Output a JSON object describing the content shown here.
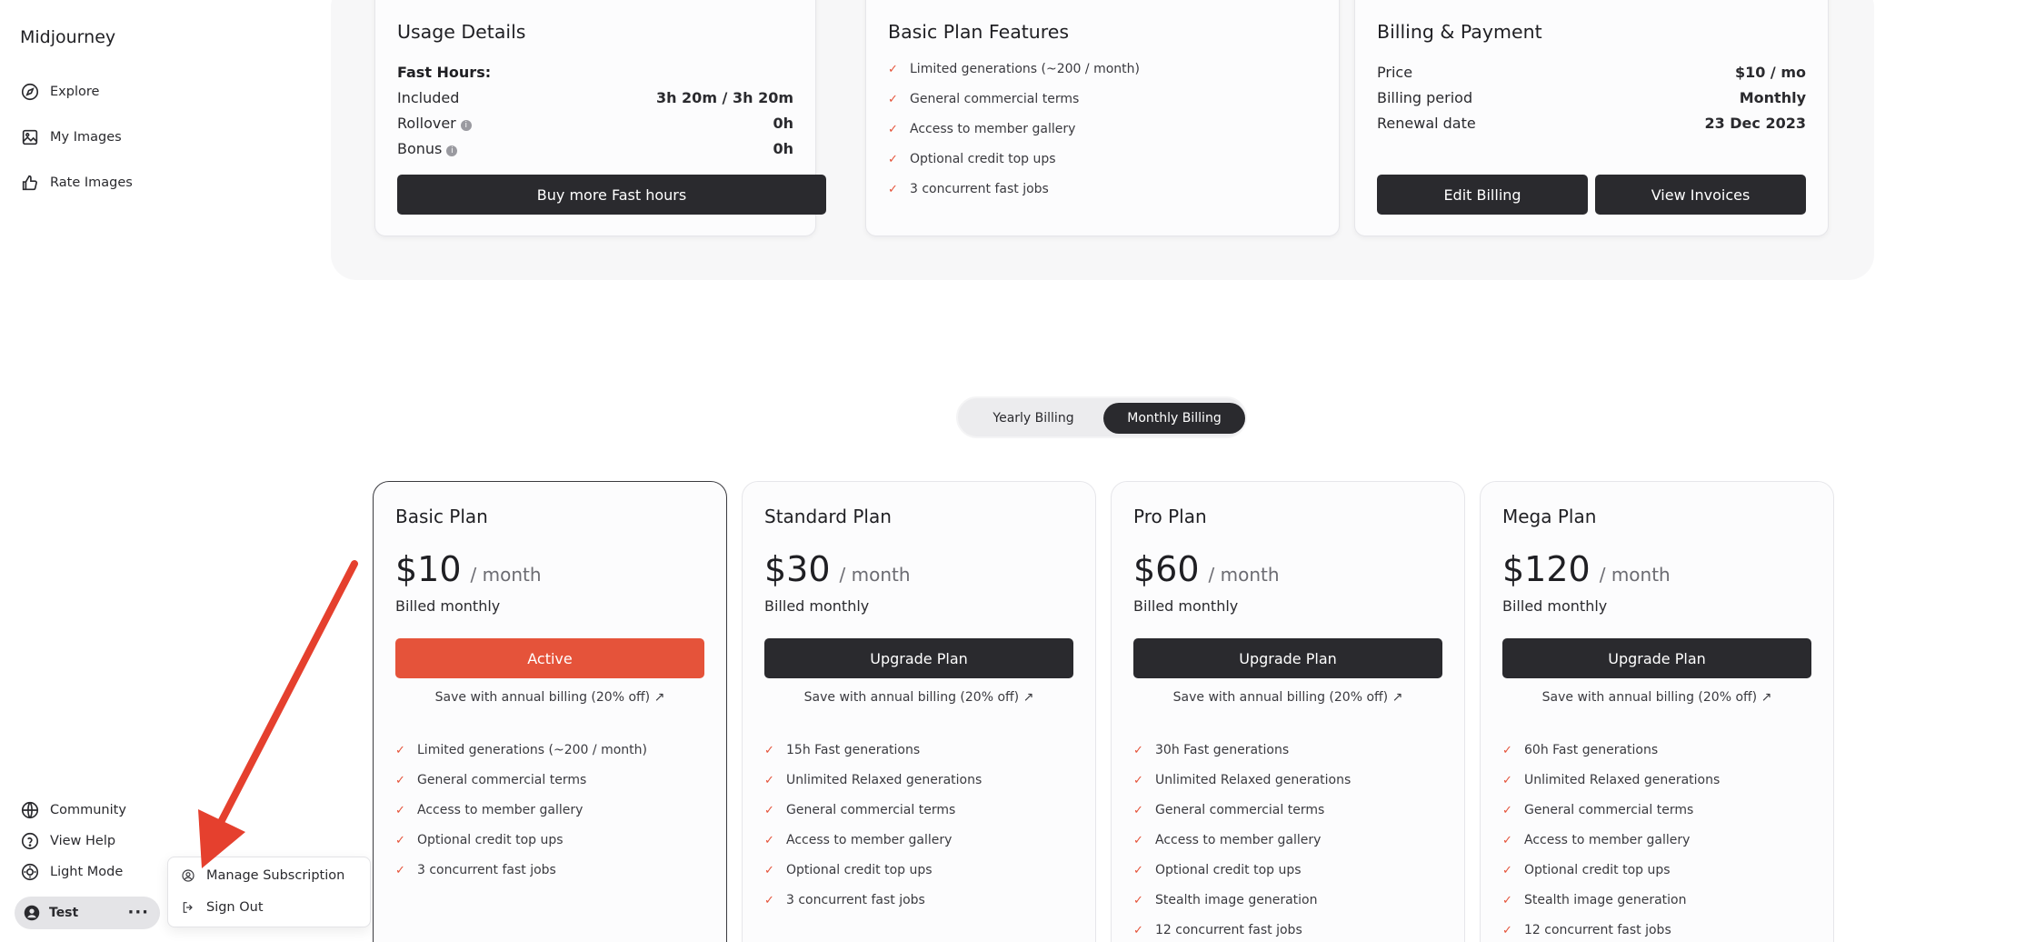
{
  "sidebar": {
    "brand": "Midjourney",
    "nav": [
      {
        "label": "Explore",
        "icon": "compass-icon"
      },
      {
        "label": "My Images",
        "icon": "image-icon"
      },
      {
        "label": "Rate Images",
        "icon": "thumbs-up-icon"
      }
    ],
    "bottom_nav": [
      {
        "label": "Community",
        "icon": "globe-icon"
      },
      {
        "label": "View Help",
        "icon": "help-circle-icon"
      },
      {
        "label": "Light Mode",
        "icon": "sun-icon"
      }
    ],
    "user": {
      "name": "Test",
      "menu_icon": "more-horizontal-icon"
    }
  },
  "user_menu": {
    "items": [
      {
        "label": "Manage Subscription",
        "icon": "user-circle-icon"
      },
      {
        "label": "Sign Out",
        "icon": "sign-out-icon"
      }
    ]
  },
  "usage": {
    "title": "Usage Details",
    "fast_hours_label": "Fast Hours:",
    "rows": [
      {
        "label": "Included",
        "value": "3h 20m / 3h 20m"
      },
      {
        "label": "Rollover",
        "value": "0h"
      },
      {
        "label": "Bonus",
        "value": "0h"
      }
    ],
    "button": "Buy more Fast hours"
  },
  "features": {
    "title": "Basic Plan Features",
    "items": [
      "Limited generations (~200 / month)",
      "General commercial terms",
      "Access to member gallery",
      "Optional credit top ups",
      "3 concurrent fast jobs"
    ]
  },
  "billing": {
    "title": "Billing & Payment",
    "rows": [
      {
        "label": "Price",
        "value": "$10 / mo"
      },
      {
        "label": "Billing period",
        "value": "Monthly"
      },
      {
        "label": "Renewal date",
        "value": "23 Dec 2023"
      }
    ],
    "edit_button": "Edit Billing",
    "invoices_button": "View Invoices"
  },
  "billing_toggle": {
    "yearly": "Yearly Billing",
    "monthly": "Monthly Billing",
    "selected": "Monthly Billing"
  },
  "plans": [
    {
      "name": "Basic Plan",
      "price": "$10",
      "period": "/ month",
      "billed": "Billed monthly",
      "button": "Active",
      "active": true,
      "save": "Save with annual billing (20% off)",
      "features": [
        "Limited generations (~200 / month)",
        "General commercial terms",
        "Access to member gallery",
        "Optional credit top ups",
        "3 concurrent fast jobs"
      ]
    },
    {
      "name": "Standard Plan",
      "price": "$30",
      "period": "/ month",
      "billed": "Billed monthly",
      "button": "Upgrade Plan",
      "active": false,
      "save": "Save with annual billing (20% off)",
      "features": [
        "15h Fast generations",
        "Unlimited Relaxed generations",
        "General commercial terms",
        "Access to member gallery",
        "Optional credit top ups",
        "3 concurrent fast jobs"
      ]
    },
    {
      "name": "Pro Plan",
      "price": "$60",
      "period": "/ month",
      "billed": "Billed monthly",
      "button": "Upgrade Plan",
      "active": false,
      "save": "Save with annual billing (20% off)",
      "features": [
        "30h Fast generations",
        "Unlimited Relaxed generations",
        "General commercial terms",
        "Access to member gallery",
        "Optional credit top ups",
        "Stealth image generation",
        "12 concurrent fast jobs"
      ]
    },
    {
      "name": "Mega Plan",
      "price": "$120",
      "period": "/ month",
      "billed": "Billed monthly",
      "button": "Upgrade Plan",
      "active": false,
      "save": "Save with annual billing (20% off)",
      "features": [
        "60h Fast generations",
        "Unlimited Relaxed generations",
        "General commercial terms",
        "Access to member gallery",
        "Optional credit top ups",
        "Stealth image generation",
        "12 concurrent fast jobs"
      ]
    }
  ],
  "colors": {
    "accent": "#e5533a",
    "dark": "#2a2a2e",
    "panel": "#f7f7f8"
  }
}
